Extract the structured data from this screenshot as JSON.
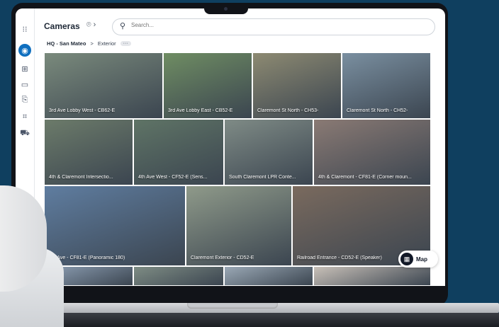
{
  "app": {
    "title": "Cameras",
    "search_placeholder": "Search..."
  },
  "breadcrumb": {
    "root": "HQ - San Mateo",
    "separator": ">",
    "current": "Exterior",
    "more": "···"
  },
  "sidebar": {
    "icons": [
      "apps-grid-icon",
      "cameras-icon",
      "layout-icon",
      "archive-icon",
      "device-icon",
      "person-scan-icon",
      "vehicle-icon"
    ]
  },
  "tiles": [
    {
      "label": "3rd Ave Lobby West - CB62-E",
      "color": "#7a8a7c"
    },
    {
      "label": "3rd Ave Lobby East - CB52-E",
      "color": "#6f8d63"
    },
    {
      "label": "Claremont St North - CH53-",
      "color": "#8d8a72"
    },
    {
      "label": "Claremont St North - CH52-",
      "color": "#7a8fa0"
    },
    {
      "label": "4th & Claremont Intersectio...",
      "color": "#6c7b6a"
    },
    {
      "label": "4th Ave West - CF52-E (Sens...",
      "color": "#5f7466"
    },
    {
      "label": "South Claremont LPR Conte...",
      "color": "#7f8b86"
    },
    {
      "label": "4th & Claremont - CF81-E (Corner moun...",
      "color": "#8a7a74"
    },
    {
      "label": "4th Ave - CF81-E (Panoramic 180)",
      "color": "#5f7da0"
    },
    {
      "label": "Claremont Exterior - CD52-E",
      "color": "#8f9a8a"
    },
    {
      "label": "Railroad Entrance - CD52-E (Speaker)",
      "color": "#7a6a5e"
    },
    {
      "label": "",
      "color": "#8ea0b5"
    },
    {
      "label": "",
      "color": "#7e8c84"
    },
    {
      "label": "",
      "color": "#9aa8b5"
    },
    {
      "label": "",
      "color": "#c8c0b8"
    }
  ],
  "map_button": {
    "label": "Map"
  },
  "colors": {
    "accent": "#0f6fbf",
    "background": "#0f3f5f"
  }
}
